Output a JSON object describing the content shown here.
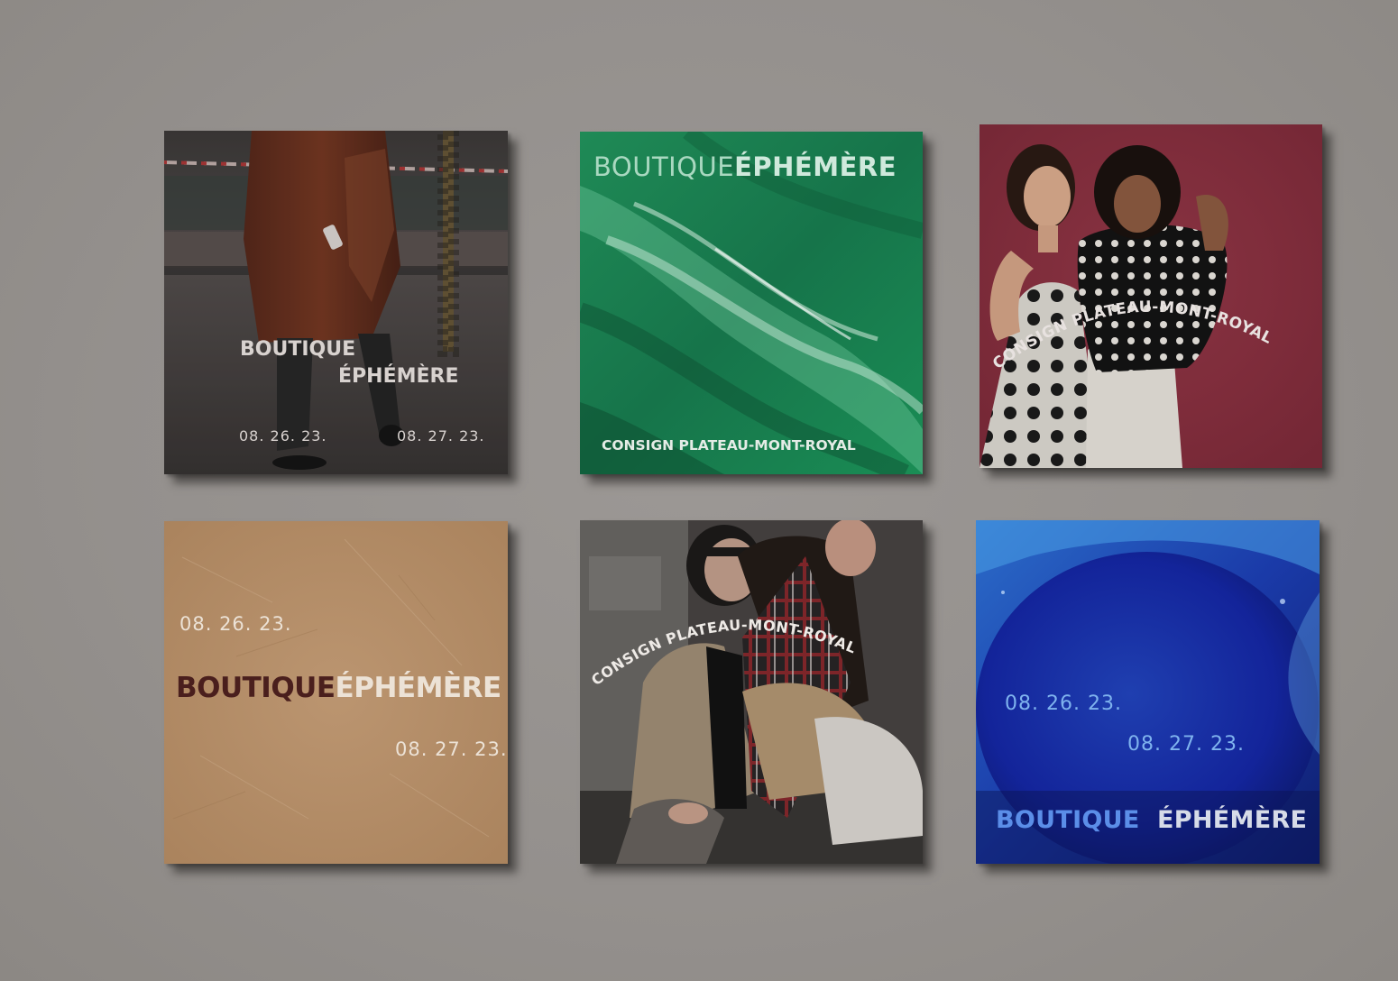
{
  "cards": [
    {
      "title_line1": "BOUTIQUE",
      "title_line2": "ÉPHÉMÈRE",
      "date_start": "08. 26. 23.",
      "date_end": "08. 27. 23.",
      "photo": "street-legs-brown-coat"
    },
    {
      "title_word1": "BOUTIQUE",
      "title_word2": "ÉPHÉMÈRE",
      "subtitle": "CONSIGN PLATEAU-MONT-ROYAL",
      "photo": "green-marble-texture"
    },
    {
      "arc_text": "CONSIGN PLATEAU-MONT-ROYAL",
      "photo": "two-women-polka-dot-dresses"
    },
    {
      "date_start": "08. 26. 23.",
      "title_word1": "BOUTIQUE",
      "title_word2": "ÉPHÉMÈRE",
      "date_end": "08. 27. 23.",
      "photo": "kraft-paper-texture"
    },
    {
      "arc_text": "CONSIGN PLATEAU-MONT-ROYAL",
      "photo": "couple-sitting-plaid-scarf"
    },
    {
      "date_start": "08. 26. 23.",
      "date_end": "08. 27. 23.",
      "title_word1": "BOUTIQUE",
      "title_word2": "ÉPHÉMÈRE",
      "photo": "blue-light-leak"
    }
  ],
  "colors": {
    "background": "#96928f",
    "card1_base": "#4a4443",
    "card2_base": "#1e8a55",
    "card3_base": "#87303f",
    "card4_base": "#b58e66",
    "card4_title_dark": "#4a1f1d",
    "card4_title_light": "#ece2d6",
    "card5_base": "#3d3a38",
    "card6_base": "#1a2f9e",
    "card6_title_accent": "#5b8ee8"
  }
}
